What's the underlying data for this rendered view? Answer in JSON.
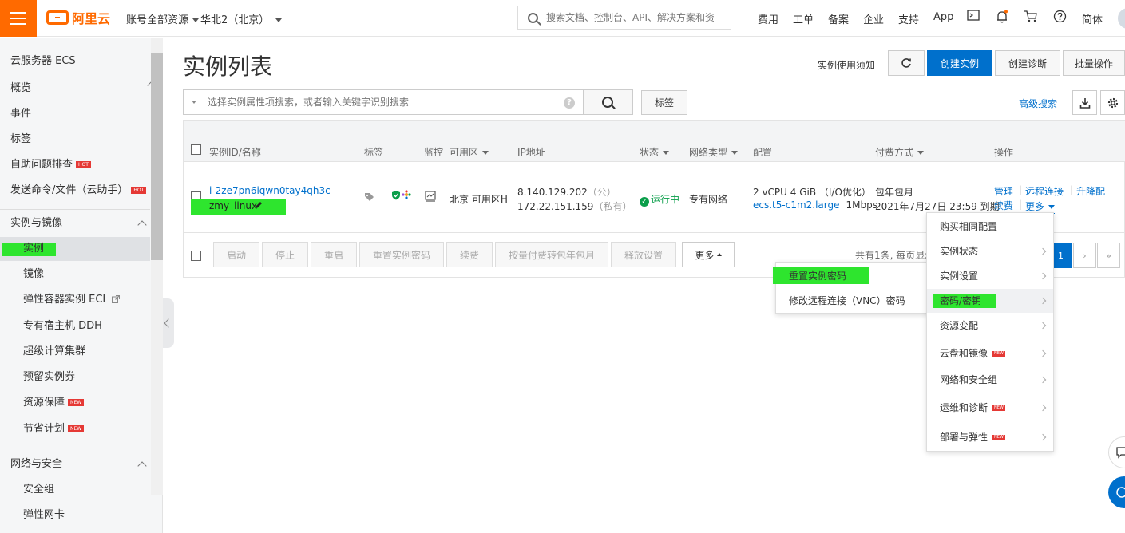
{
  "topbar": {
    "brand": "阿里云",
    "resource_scope": "账号全部资源",
    "region": "华北2（北京）",
    "search_placeholder": "搜索文档、控制台、API、解决方案和资源",
    "nav": [
      "费用",
      "工单",
      "备案",
      "企业",
      "支持",
      "App"
    ],
    "language": "简体",
    "accent": "#ff6a00"
  },
  "sidebar": {
    "title": "云服务器 ECS",
    "items": [
      {
        "label": "概览"
      },
      {
        "label": "事件"
      },
      {
        "label": "标签"
      },
      {
        "label": "自助问题排查",
        "badge": "HOT"
      },
      {
        "label": "发送命令/文件（云助手）",
        "badge": "HOT"
      }
    ],
    "section1": "实例与镜像",
    "section1_items": [
      {
        "label": "实例"
      },
      {
        "label": "镜像"
      },
      {
        "label": "弹性容器实例 ECI"
      },
      {
        "label": "专有宿主机 DDH"
      },
      {
        "label": "超级计算集群"
      },
      {
        "label": "预留实例券"
      },
      {
        "label": "资源保障",
        "badge": "NEW"
      },
      {
        "label": "节省计划",
        "badge": "NEW"
      }
    ],
    "section2": "网络与安全",
    "section2_items": [
      {
        "label": "安全组"
      },
      {
        "label": "弹性网卡"
      }
    ]
  },
  "main": {
    "title": "实例列表",
    "notice": "实例使用须知",
    "create_label": "创建实例",
    "diagnose_label": "创建诊断",
    "batch_label": "批量操作",
    "filter_placeholder": "选择实例属性项搜索，或者输入关键字识别搜索",
    "tag_button": "标签",
    "advanced_search": "高级搜索",
    "primary_color": "#0070cc"
  },
  "table": {
    "columns": [
      "实例ID/名称",
      "标签",
      "监控",
      "可用区",
      "IP地址",
      "状态",
      "网络类型",
      "配置",
      "付费方式",
      "操作"
    ],
    "row": {
      "instance_id": "i-2ze7pn6iqwn0tay4qh3c",
      "name": "zmy_linux",
      "zone": "北京 可用区H",
      "ip_public": "8.140.129.202",
      "ip_public_tag": "（公）",
      "ip_private": "172.22.151.159",
      "ip_private_tag": "（私有）",
      "status": "运行中",
      "network": "专有网络",
      "spec": "2 vCPU 4 GiB （I/O优化）",
      "instance_type": "ecs.t5-c1m2.large",
      "bandwidth": "1Mbps",
      "billing": "包年包月",
      "expire": "2021年7月27日 23:59 到期",
      "actions": [
        "管理",
        "远程连接",
        "升降配",
        "续费",
        "更多"
      ]
    },
    "bulk_actions": [
      "启动",
      "停止",
      "重启",
      "重置实例密码",
      "续费",
      "按量付费转包年包月",
      "释放设置",
      "更多"
    ],
    "pager_text": "共有1条, 每页显示",
    "current_page": "1"
  },
  "more_menu": {
    "items": [
      {
        "label": "购买相同配置",
        "submenu": false
      },
      {
        "label": "实例状态",
        "submenu": true
      },
      {
        "label": "实例设置",
        "submenu": true
      },
      {
        "label": "密码/密钥",
        "submenu": true
      },
      {
        "label": "资源变配",
        "submenu": true
      },
      {
        "label": "云盘和镜像",
        "submenu": true,
        "badge": "NEW"
      },
      {
        "label": "网络和安全组",
        "submenu": true
      },
      {
        "label": "运维和诊断",
        "submenu": true,
        "badge": "NEW"
      },
      {
        "label": "部署与弹性",
        "submenu": true,
        "badge": "NEW"
      }
    ]
  },
  "password_submenu": {
    "items": [
      {
        "label": "重置实例密码"
      },
      {
        "label": "修改远程连接（VNC）密码"
      }
    ]
  },
  "highlight_color": "#2ee52e"
}
